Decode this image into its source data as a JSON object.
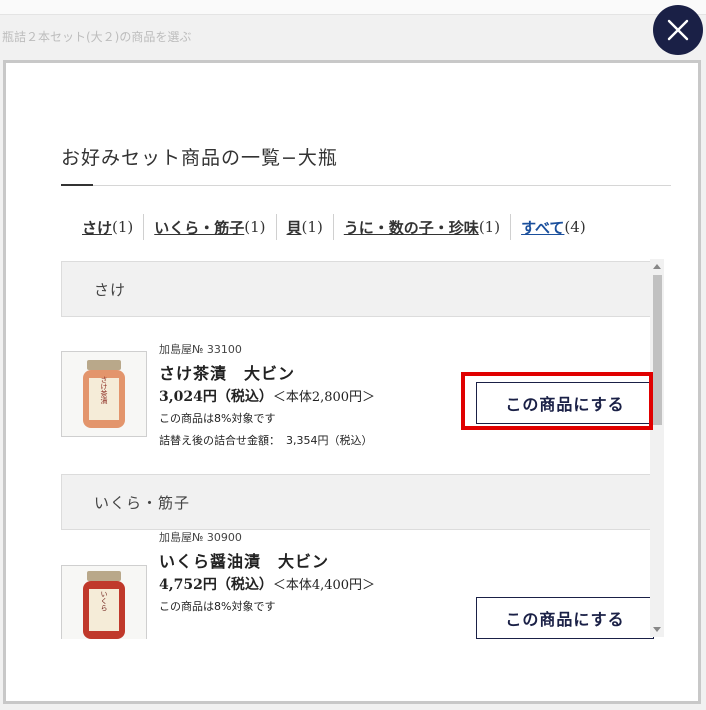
{
  "background": {
    "title": "瓶詰２本セット(大２)の商品を選ぶ"
  },
  "modal": {
    "title": "お好みセット商品の一覧−大瓶",
    "close_icon": "close-icon",
    "tabs": [
      {
        "label": "さけ",
        "count": "(1)"
      },
      {
        "label": "いくら・筋子",
        "count": "(1)"
      },
      {
        "label": "貝",
        "count": "(1)"
      },
      {
        "label": "うに・数の子・珍味",
        "count": "(1)"
      },
      {
        "label": "すべて",
        "count": "(4)",
        "active": true
      }
    ]
  },
  "sections": [
    {
      "heading": "さけ",
      "product": {
        "code": "加島屋№ 33100",
        "name": "さけ茶漬　大ビン",
        "price": "3,024円（税込）",
        "base_price": "＜本体2,800円＞",
        "tax_note": "この商品は8%対象です",
        "total_label": "詰替え後の詰合せ金額：",
        "total_value": "3,354円（税込）",
        "button_label": "この商品にする",
        "jar_label": "さけ茶漬"
      }
    },
    {
      "heading": "いくら・筋子",
      "product": {
        "code": "加島屋№ 30900",
        "name": "いくら醤油漬　大ビン",
        "price": "4,752円（税込）",
        "base_price": "＜本体4,400円＞",
        "tax_note": "この商品は8%対象です",
        "button_label": "この商品にする",
        "jar_label": "いくら"
      }
    }
  ],
  "colors": {
    "navy": "#1a2046",
    "highlight": "#e00000",
    "active_tab": "#1a4f9c"
  }
}
